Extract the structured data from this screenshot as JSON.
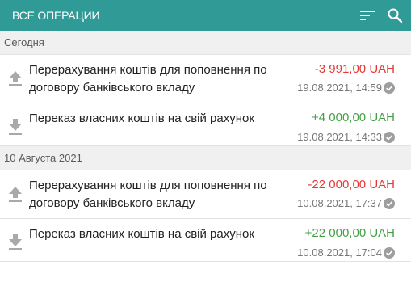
{
  "toolbar": {
    "title": "ВСЕ ОПЕРАЦИИ",
    "filter_icon": "filter-icon",
    "search_icon": "search-icon",
    "bg_color": "#2f9a96"
  },
  "colors": {
    "negative": "#e53935",
    "positive": "#43a047",
    "check": "#9e9e9e"
  },
  "groups": [
    {
      "label": "Сегодня",
      "operations": [
        {
          "icon": "upload-arrow-icon",
          "description": "Перерахування коштів для поповнення по договору банківського вкладу",
          "amount": "-3 991,00 UAH",
          "datetime": "19.08.2021, 14:59",
          "status_icon": "check-circle-icon"
        },
        {
          "icon": "download-arrow-icon",
          "description": "Переказ власних коштів на свій рахунок",
          "amount": "+4 000,00 UAH",
          "datetime": "19.08.2021, 14:33",
          "status_icon": "check-circle-icon"
        }
      ]
    },
    {
      "label": "10 Августа 2021",
      "operations": [
        {
          "icon": "upload-arrow-icon",
          "description": "Перерахування коштів для поповнення по договору банківського вкладу",
          "amount": "-22 000,00 UAH",
          "datetime": "10.08.2021, 17:37",
          "status_icon": "check-circle-icon"
        },
        {
          "icon": "download-arrow-icon",
          "description": "Переказ власних коштів на свій рахунок",
          "amount": "+22 000,00 UAH",
          "datetime": "10.08.2021, 17:04",
          "status_icon": "check-circle-icon"
        }
      ]
    }
  ]
}
